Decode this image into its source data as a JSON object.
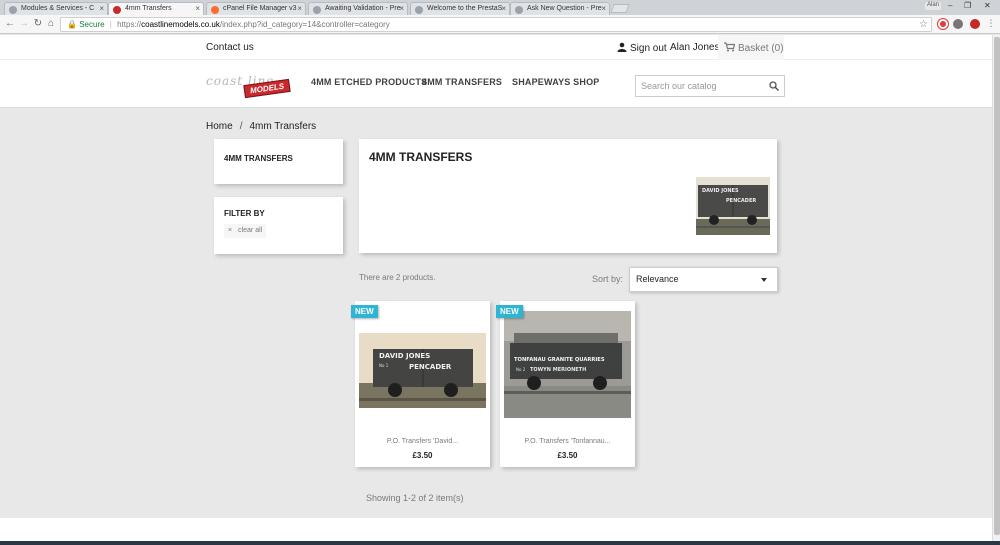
{
  "browser": {
    "tabs": [
      {
        "title": "Modules & Services - C",
        "active": false
      },
      {
        "title": "4mm Transfers",
        "active": true
      },
      {
        "title": "cPanel File Manager v3",
        "active": false
      },
      {
        "title": "Awaiting Validation - Pre",
        "active": false
      },
      {
        "title": "Welcome to the PrestaS",
        "active": false
      },
      {
        "title": "Ask New Question - Pre",
        "active": false
      }
    ],
    "tab_close": "×",
    "user_chip": "Alan",
    "window_controls": {
      "minimize": "–",
      "maximize": "❐",
      "close": "✕"
    },
    "nav": {
      "back": "←",
      "forward": "→",
      "reload": "↻",
      "home": "⌂"
    },
    "address": {
      "secure_label": "Secure",
      "protocol": "https://",
      "domain": "coastlinemodels.co.uk",
      "path": "/index.php?id_category=14&controller=category"
    },
    "bookmark_icon": "☆"
  },
  "topnav": {
    "contact": "Contact us",
    "signout": "Sign out",
    "username": "Alan Jones",
    "basket": "Basket (0)"
  },
  "header": {
    "logo_script": "coast line",
    "logo_badge": "MODELS",
    "menu": [
      "4MM ETCHED PRODUCTS",
      "4MM TRANSFERS",
      "SHAPEWAYS SHOP"
    ],
    "search_placeholder": "Search our catalog"
  },
  "breadcrumb": {
    "home": "Home",
    "separator": "/",
    "current": "4mm Transfers"
  },
  "sidebar": {
    "category_title": "4MM TRANSFERS",
    "filter_title": "FILTER BY",
    "clear_x": "×",
    "clear_all": "clear all"
  },
  "category": {
    "title": "4MM TRANSFERS",
    "thumb_text_1": "DAVID    JONES",
    "thumb_text_2": "PENCADER"
  },
  "listing": {
    "count_text": "There are 2 products.",
    "sort_label": "Sort by:",
    "sort_value": "Relevance",
    "showing": "Showing 1-2 of 2 item(s)"
  },
  "products": [
    {
      "badge": "NEW",
      "name": "P.O. Transfers 'David...",
      "price": "£3.50",
      "img_line1": "DAVID      JONES",
      "img_line2": "PENCADER",
      "img_small": "No 1"
    },
    {
      "badge": "NEW",
      "name": "P.O. Transfers 'Tonfannau...",
      "price": "£3.50",
      "img_line1": "TONFANAU GRANITE QUARRIES",
      "img_line2": "TOWYN   MERIONETH",
      "img_small": "No 2"
    }
  ],
  "colors": {
    "accent": "#2fb5d2",
    "text": "#232323",
    "muted": "#7a7a7a",
    "page_bg": "#e8e8e8"
  }
}
